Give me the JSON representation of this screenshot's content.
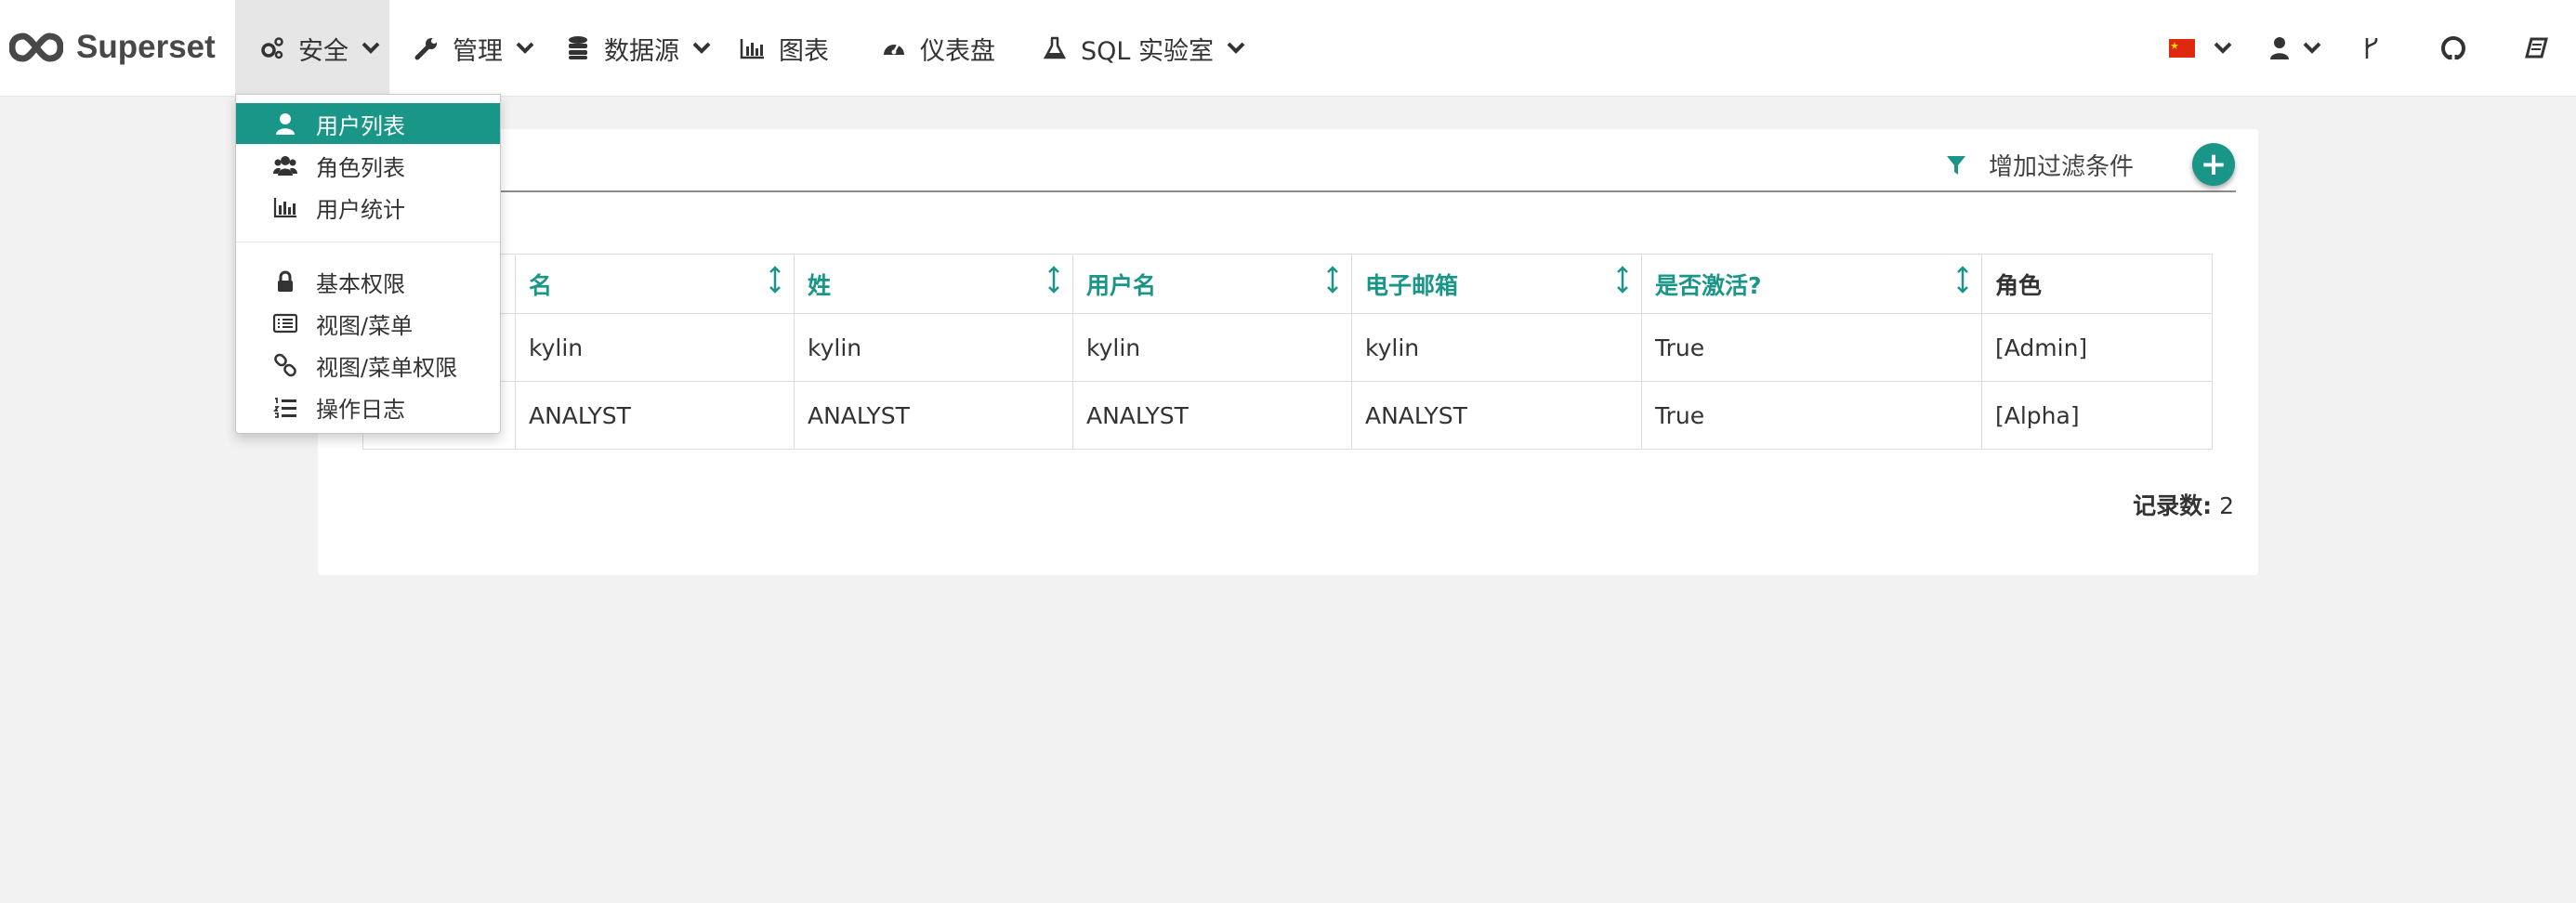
{
  "app": {
    "brand": "Superset"
  },
  "nav": {
    "security": "安全",
    "manage": "管理",
    "sources": "数据源",
    "charts": "图表",
    "dashboards": "仪表盘",
    "sqllab": "SQL 实验室"
  },
  "security_menu": {
    "items": [
      {
        "label": "用户列表",
        "icon": "user-icon"
      },
      {
        "label": "角色列表",
        "icon": "group-icon"
      },
      {
        "label": "用户统计",
        "icon": "bar-chart-icon"
      },
      {
        "label": "基本权限",
        "icon": "lock-icon"
      },
      {
        "label": "视图/菜单",
        "icon": "list-alt-icon"
      },
      {
        "label": "视图/菜单权限",
        "icon": "link-icon"
      },
      {
        "label": "操作日志",
        "icon": "list-ol-icon"
      }
    ],
    "active_index": 0
  },
  "filter": {
    "label": "增加过滤条件",
    "add_symbol": "+"
  },
  "table": {
    "columns": [
      "名",
      "姓",
      "用户名",
      "电子邮箱",
      "是否激活?",
      "角色"
    ],
    "rows": [
      [
        "kylin",
        "kylin",
        "kylin",
        "kylin",
        "True",
        "[Admin]"
      ],
      [
        "ANALYST",
        "ANALYST",
        "ANALYST",
        "ANALYST",
        "True",
        "[Alpha]"
      ]
    ]
  },
  "record_count": {
    "label": "记录数:",
    "value": "2"
  },
  "colors": {
    "accent": "#1a9688",
    "navbar": "#ffffff",
    "background": "#f2f2f2"
  }
}
